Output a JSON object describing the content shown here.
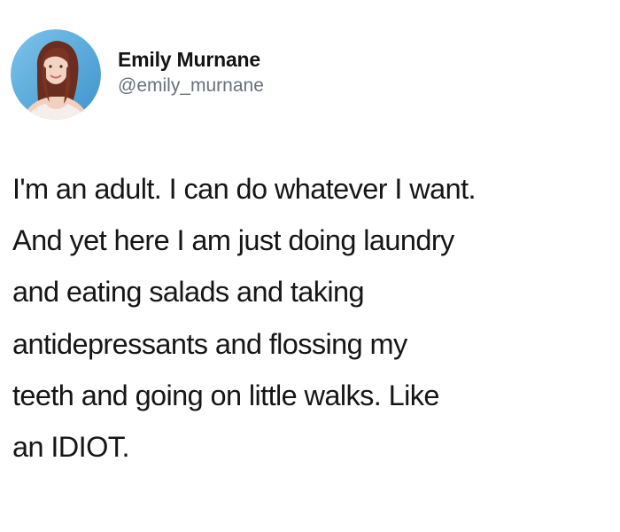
{
  "author": {
    "display_name": "Emily Murnane",
    "handle": "@emily_murnane",
    "avatar_icon": "profile-photo-avatar"
  },
  "tweet": {
    "lines": [
      "I'm an adult. I can do whatever I want.",
      "And yet here I am just doing laundry",
      "and eating salads and taking",
      "antidepressants and flossing my",
      "teeth and going on little walks. Like",
      "an IDIOT."
    ]
  },
  "colors": {
    "background": "#ffffff",
    "text": "#161616",
    "handle": "#6b7278",
    "avatar_ring": "#5aa9dc"
  }
}
